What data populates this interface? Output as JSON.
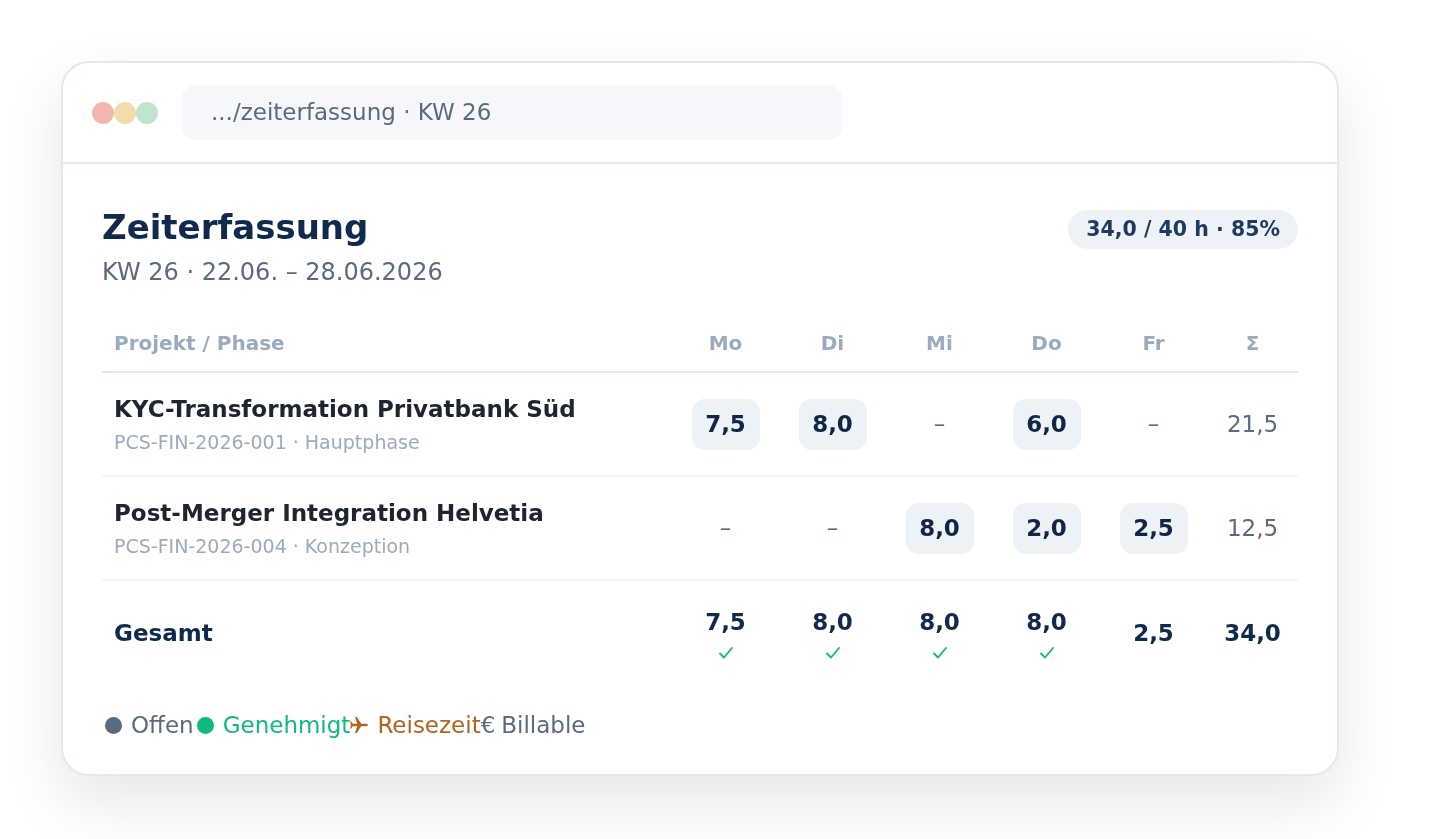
{
  "window": {
    "address": ".../zeiterfassung · KW 26"
  },
  "header": {
    "title": "Zeiterfassung",
    "subtitle": "KW 26 · 22.06. – 28.06.2026",
    "badge": "34,0 / 40 h · 85%"
  },
  "table": {
    "columns": [
      "Projekt / Phase",
      "Mo",
      "Di",
      "Mi",
      "Do",
      "Fr",
      "Σ"
    ],
    "rows": [
      {
        "cells": [
          {
            "kind": "project",
            "name": "KYC-Transformation Privatbank Süd",
            "code": "PCS-FIN-2026-001 · Hauptphase"
          },
          {
            "kind": "entry",
            "text": "7,5"
          },
          {
            "kind": "entry",
            "text": "8,0"
          },
          {
            "kind": "empty",
            "text": "–"
          },
          {
            "kind": "entry",
            "text": "6,0"
          },
          {
            "kind": "empty",
            "text": "–"
          },
          {
            "kind": "sum",
            "text": "21,5"
          }
        ]
      },
      {
        "cells": [
          {
            "kind": "project",
            "name": "Post-Merger Integration Helvetia",
            "code": "PCS-FIN-2026-004 · Konzeption"
          },
          {
            "kind": "empty",
            "text": "–"
          },
          {
            "kind": "empty",
            "text": "–"
          },
          {
            "kind": "entry",
            "text": "8,0"
          },
          {
            "kind": "entry",
            "text": "2,0"
          },
          {
            "kind": "entry",
            "text": "2,5"
          },
          {
            "kind": "sum",
            "text": "12,5"
          }
        ]
      }
    ],
    "totals": {
      "label": "Gesamt",
      "days": [
        {
          "text": "7,5",
          "approved": true
        },
        {
          "text": "8,0",
          "approved": true
        },
        {
          "text": "8,0",
          "approved": true
        },
        {
          "text": "8,0",
          "approved": true
        },
        {
          "text": "2,5",
          "approved": false
        }
      ],
      "total": "34,0"
    }
  },
  "legend": [
    {
      "kind": "dot",
      "label": "Offen",
      "color": "#5b6b7f"
    },
    {
      "kind": "dot",
      "label": "Genehmigt",
      "color": "#10b981"
    },
    {
      "kind": "plane",
      "label": "Reisezeit",
      "color": "#b4621e"
    },
    {
      "kind": "symbol",
      "symbol": "€",
      "label": "Billable",
      "color": "#5b6b7f"
    }
  ]
}
